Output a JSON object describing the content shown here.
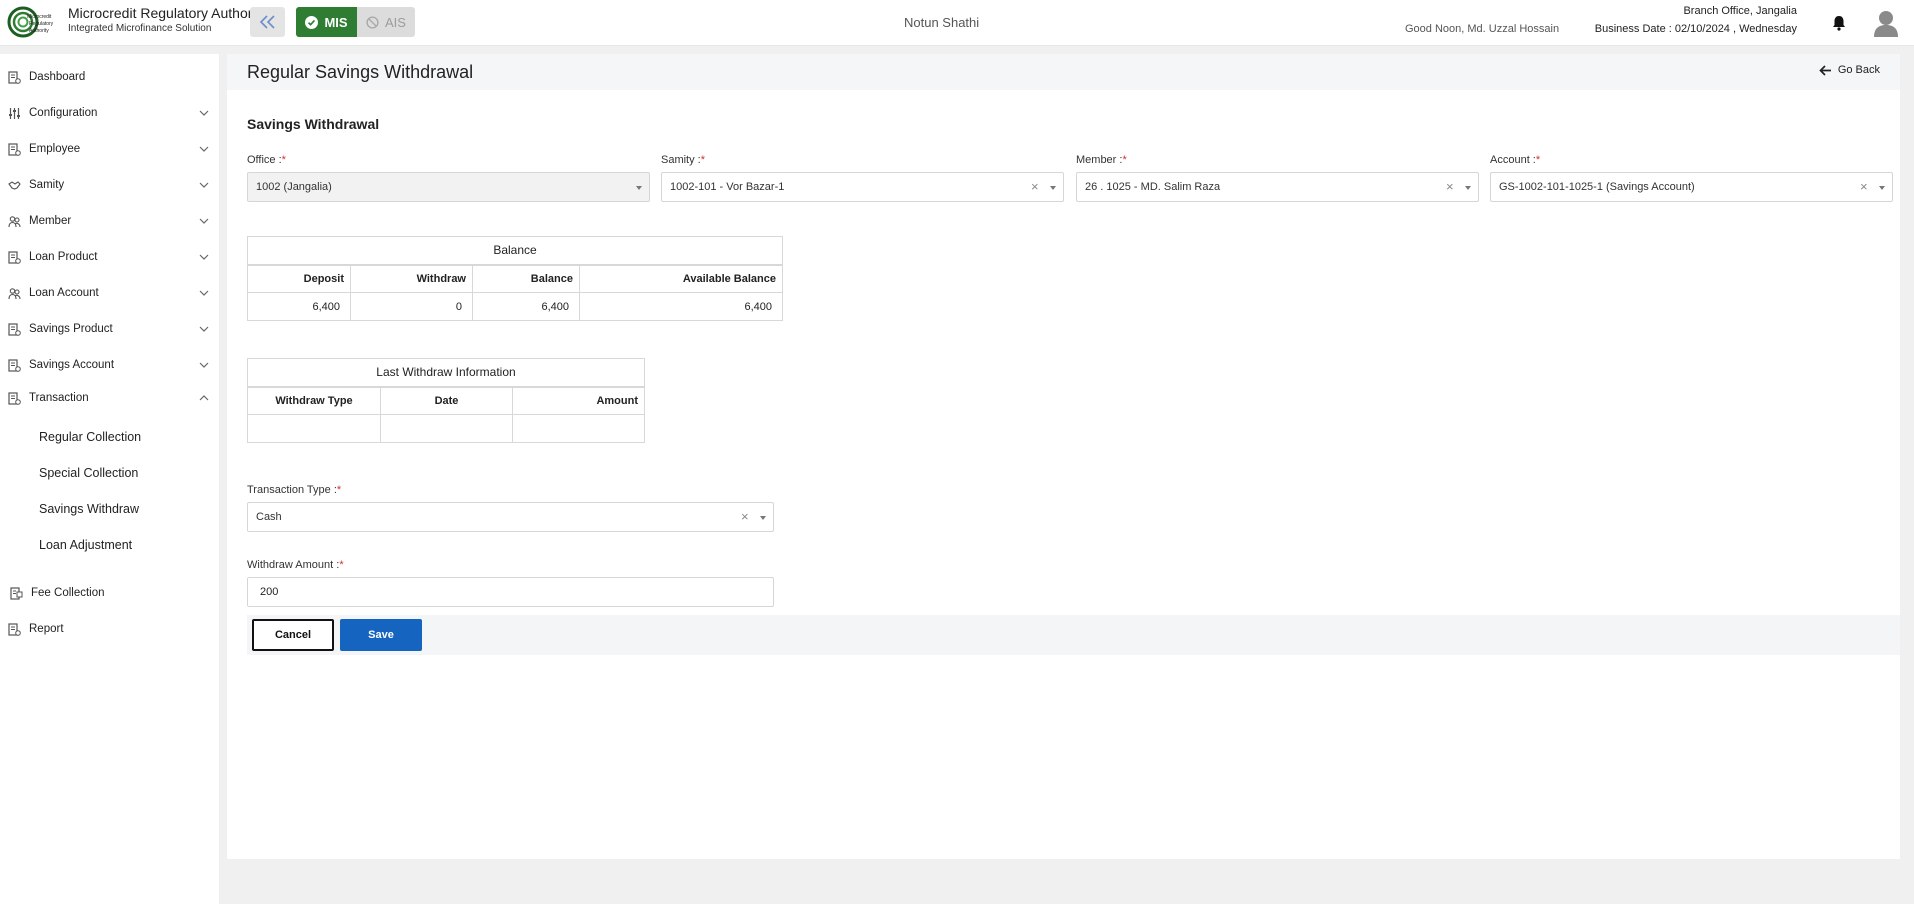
{
  "header": {
    "org_name": "Microcredit Regulatory Authority",
    "org_sub": "Integrated Microfinance Solution",
    "logo_text": "Microcredit Regulatory Authority",
    "mode_mis": "MIS",
    "mode_ais": "AIS",
    "app_title": "Notun Shathi",
    "greeting": "Good Noon, Md. Uzzal Hossain",
    "branch": "Branch Office, Jangalia",
    "business_date": "Business Date : 02/10/2024 , Wednesday"
  },
  "colors": {
    "mis_green": "#2e7d32",
    "save_blue": "#1565c0",
    "required_red": "#d32f2f"
  },
  "sidebar": {
    "items": [
      {
        "label": "Dashboard",
        "icon": "dashboard-icon",
        "expandable": false
      },
      {
        "label": "Configuration",
        "icon": "sliders-icon",
        "expandable": true
      },
      {
        "label": "Employee",
        "icon": "document-icon",
        "expandable": true
      },
      {
        "label": "Samity",
        "icon": "handshake-icon",
        "expandable": true
      },
      {
        "label": "Member",
        "icon": "members-icon",
        "expandable": true
      },
      {
        "label": "Loan Product",
        "icon": "document-icon",
        "expandable": true
      },
      {
        "label": "Loan Account",
        "icon": "members-icon",
        "expandable": true
      },
      {
        "label": "Savings Product",
        "icon": "document-icon",
        "expandable": true
      },
      {
        "label": "Savings Account",
        "icon": "document-icon",
        "expandable": true
      },
      {
        "label": "Transaction",
        "icon": "document-icon",
        "expandable": true,
        "expanded": true
      },
      {
        "label": "Fee Collection",
        "icon": "receipt-icon",
        "expandable": false
      },
      {
        "label": "Report",
        "icon": "document-icon",
        "expandable": false
      }
    ],
    "transaction_sub": [
      "Regular Collection",
      "Special Collection",
      "Savings Withdraw",
      "Loan Adjustment"
    ]
  },
  "page": {
    "title": "Regular Savings Withdrawal",
    "go_back": "Go Back",
    "section_title": "Savings Withdrawal"
  },
  "form": {
    "office": {
      "label": "Office :",
      "value": "1002 (Jangalia)"
    },
    "samity": {
      "label": "Samity :",
      "value": "1002-101 - Vor Bazar-1"
    },
    "member": {
      "label": "Member :",
      "value": "26 . 1025 - MD. Salim Raza"
    },
    "account": {
      "label": "Account :",
      "value": "GS-1002-101-1025-1 (Savings Account)"
    },
    "required_mark": "*",
    "transaction_type": {
      "label": "Transaction Type :",
      "value": "Cash"
    },
    "withdraw_amount": {
      "label": "Withdraw Amount :",
      "value": "200"
    }
  },
  "balance_table": {
    "caption": "Balance",
    "headers": [
      "Deposit",
      "Withdraw",
      "Balance",
      "Available Balance"
    ],
    "row": [
      "6,400",
      "0",
      "6,400",
      "6,400"
    ]
  },
  "last_withdraw_table": {
    "caption": "Last Withdraw Information",
    "headers": [
      "Withdraw Type",
      "Date",
      "Amount"
    ]
  },
  "buttons": {
    "cancel": "Cancel",
    "save": "Save"
  }
}
